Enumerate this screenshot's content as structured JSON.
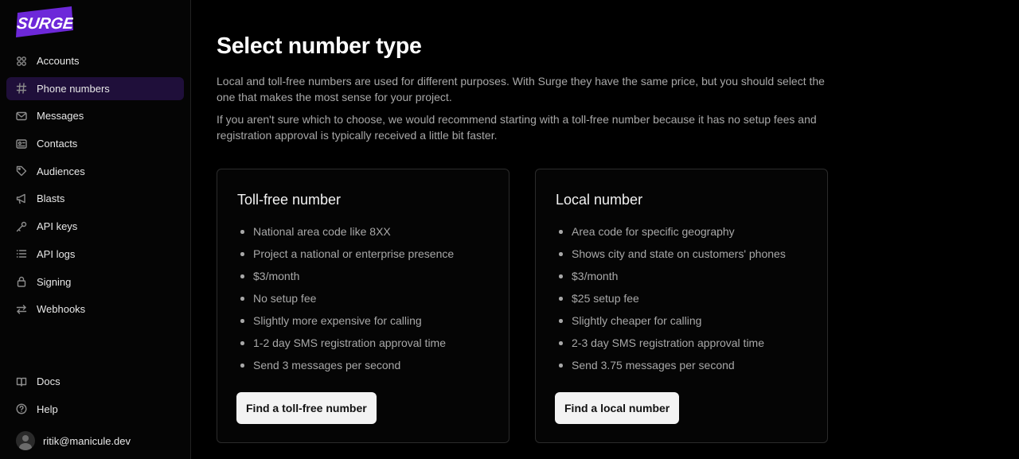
{
  "brand": {
    "logo_text": "SURGE",
    "logo_color": "#6d28d9"
  },
  "sidebar": {
    "items": [
      {
        "label": "Accounts",
        "icon": "accounts-icon",
        "active": false
      },
      {
        "label": "Phone numbers",
        "icon": "hash-icon",
        "active": true
      },
      {
        "label": "Messages",
        "icon": "envelope-icon",
        "active": false
      },
      {
        "label": "Contacts",
        "icon": "contact-card-icon",
        "active": false
      },
      {
        "label": "Audiences",
        "icon": "tag-icon",
        "active": false
      },
      {
        "label": "Blasts",
        "icon": "megaphone-icon",
        "active": false
      },
      {
        "label": "API keys",
        "icon": "key-icon",
        "active": false
      },
      {
        "label": "API logs",
        "icon": "list-icon",
        "active": false
      },
      {
        "label": "Signing",
        "icon": "lock-icon",
        "active": false
      },
      {
        "label": "Webhooks",
        "icon": "arrows-icon",
        "active": false
      }
    ],
    "bottom_items": [
      {
        "label": "Docs",
        "icon": "book-icon"
      },
      {
        "label": "Help",
        "icon": "help-circle-icon"
      }
    ],
    "user_email": "ritik@manicule.dev"
  },
  "main": {
    "title": "Select number type",
    "paragraph1": "Local and toll-free numbers are used for different purposes. With Surge they have the same price, but you should select the one that makes the most sense for your project.",
    "paragraph2": "If you aren't sure which to choose, we would recommend starting with a toll-free number because it has no setup fees and registration approval is typically received a little bit faster.",
    "cards": [
      {
        "title": "Toll-free number",
        "features": [
          "National area code like 8XX",
          "Project a national or enterprise presence",
          "$3/month",
          "No setup fee",
          "Slightly more expensive for calling",
          "1-2 day SMS registration approval time",
          "Send 3 messages per second"
        ],
        "button": "Find a toll-free number"
      },
      {
        "title": "Local number",
        "features": [
          "Area code for specific geography",
          "Shows city and state on customers' phones",
          "$3/month",
          "$25 setup fee",
          "Slightly cheaper for calling",
          "2-3 day SMS registration approval time",
          "Send 3.75 messages per second"
        ],
        "button": "Find a local number"
      }
    ]
  }
}
